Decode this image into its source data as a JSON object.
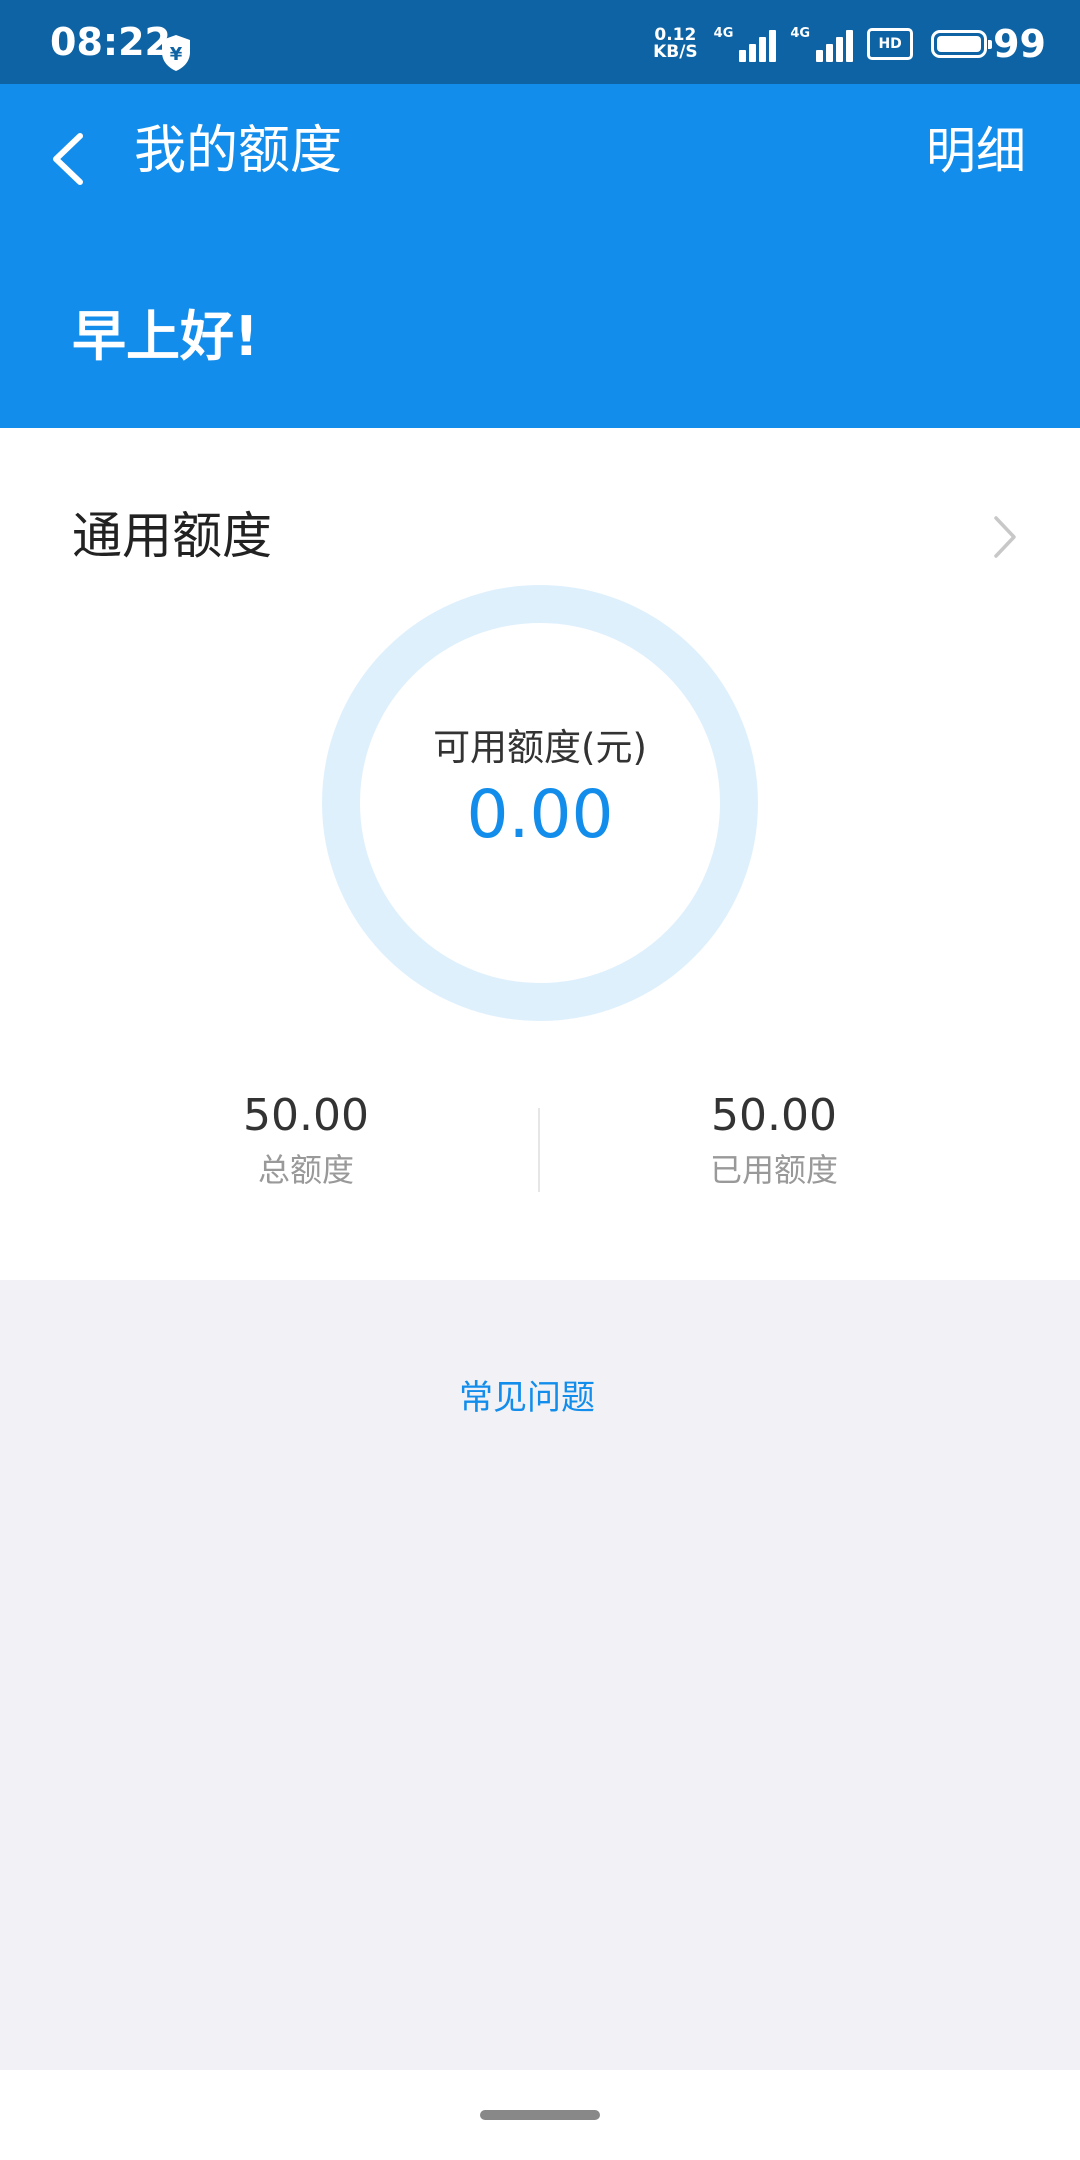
{
  "status_bar": {
    "time": "08:22",
    "shield_icon": "yen-shield-icon",
    "speed_value": "0.12",
    "speed_unit": "KB/S",
    "network_1": "4G",
    "network_2": "4G",
    "hd_label": "HD",
    "battery_level": "99"
  },
  "header": {
    "title": "我的额度",
    "detail_label": "明细",
    "greeting": "早上好!"
  },
  "credit_card": {
    "title": "通用额度",
    "available_label": "可用额度(元)",
    "available_value": "0.00",
    "available_fraction": 0.0,
    "total_value": "50.00",
    "total_label": "总额度",
    "used_value": "50.00",
    "used_label": "已用额度"
  },
  "faq_label": "常见问题",
  "colors": {
    "status_bar": "#0d63a4",
    "primary": "#138deb",
    "ring_track": "#dff0fd",
    "page_background": "#f2f2f6"
  }
}
